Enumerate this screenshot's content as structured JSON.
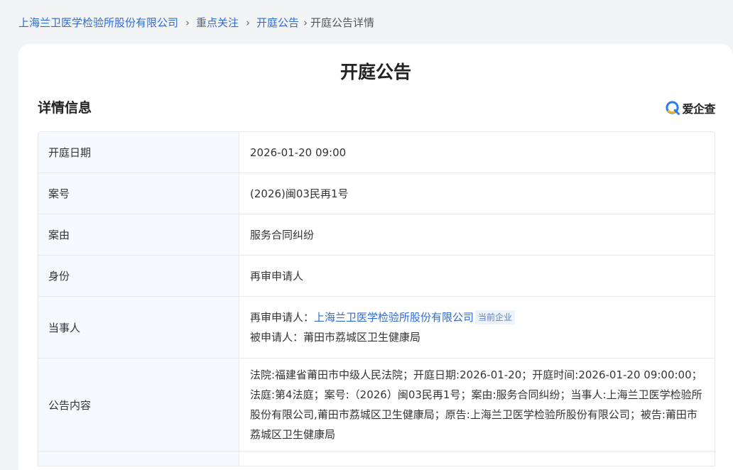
{
  "breadcrumb": {
    "items": [
      {
        "label": "上海兰卫医学检验所股份有限公司"
      },
      {
        "label": "重点关注"
      },
      {
        "label": "开庭公告"
      }
    ],
    "current": "开庭公告详情",
    "separator": "›"
  },
  "page": {
    "title": "开庭公告",
    "section_title": "详情信息",
    "brand_name": "爱企查",
    "brand_icon": "aiqicha-logo"
  },
  "colors": {
    "link": "#2d6bd9",
    "label_bg": "#f6f9fd",
    "border": "#e6e9ee",
    "page_bg": "#f3f4f6"
  },
  "details": {
    "hearing_date": {
      "label": "开庭日期",
      "value": "2026-01-20 09:00"
    },
    "case_no": {
      "label": "案号",
      "value": "(2026)闽03民再1号"
    },
    "cause": {
      "label": "案由",
      "value": "服务合同纠纷"
    },
    "role": {
      "label": "身份",
      "value": "再审申请人"
    },
    "parties": {
      "label": "当事人",
      "line1_prefix": "再审申请人：",
      "line1_company": "上海兰卫医学检验所股份有限公司",
      "line1_tag": "当前企业",
      "line2": "被申请人：莆田市荔城区卫生健康局"
    },
    "notice": {
      "label": "公告内容",
      "value": "法院:福建省莆田市中级人民法院；开庭日期:2026-01-20；开庭时间:2026-01-20 09:00:00；法庭:第4法庭；案号:（2026）闽03民再1号；案由:服务合同纠纷；当事人:上海兰卫医学检验所股份有限公司,莆田市荔城区卫生健康局；原告:上海兰卫医学检验所股份有限公司；被告:莆田市荔城区卫生健康局"
    }
  }
}
